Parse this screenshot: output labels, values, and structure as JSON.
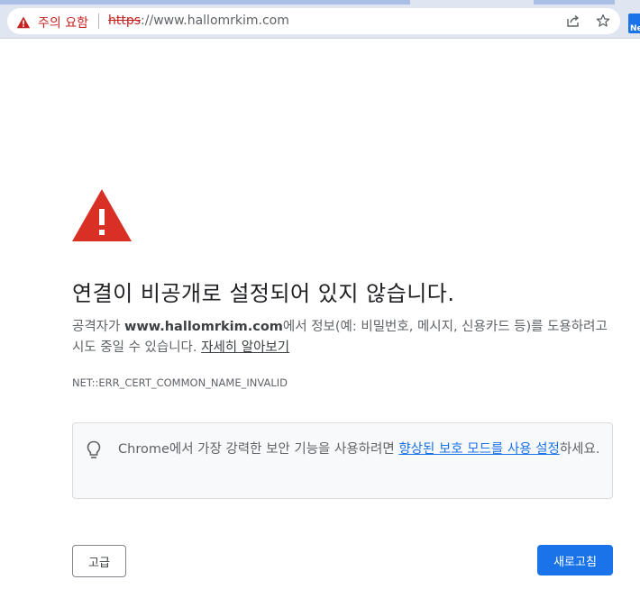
{
  "browser": {
    "security_chip_label": "주의 요함",
    "url_scheme": "https",
    "url_rest": "://www.hallomrkim.com",
    "extension_badge": "Ne",
    "icons": {
      "security": "warning-triangle-icon",
      "share": "share-icon",
      "bookmark": "star-icon"
    }
  },
  "interstitial": {
    "heading": "연결이 비공개로 설정되어 있지 않습니다.",
    "desc_prefix": "공격자가 ",
    "desc_domain": "www.hallomrkim.com",
    "desc_suffix": "에서 정보(예: 비밀번호, 메시지, 신용카드 등)를 도용하려고 시도 중일 수 있습니다. ",
    "learn_more_link": "자세히 알아보기",
    "error_code": "NET::ERR_CERT_COMMON_NAME_INVALID",
    "enhanced_prefix": "Chrome에서 가장 강력한 보안 기능을 사용하려면 ",
    "enhanced_link": "향상된 보호 모드를 사용 설정",
    "enhanced_suffix": "하세요.",
    "advanced_button": "고급",
    "reload_button": "새로고침"
  },
  "colors": {
    "warning_red": "#d93025",
    "chip_red": "#c5221f",
    "primary_blue": "#1a73e8",
    "text_dark": "#202124",
    "text_grey": "#5f6368"
  }
}
